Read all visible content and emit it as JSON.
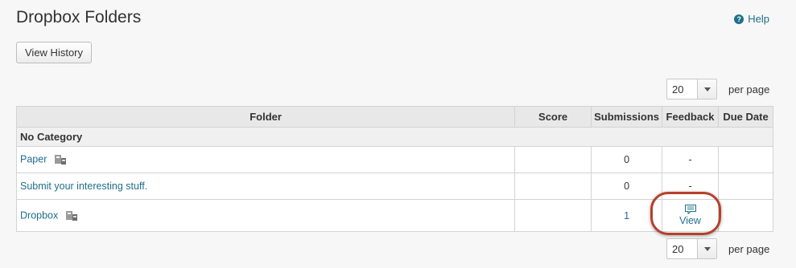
{
  "page": {
    "title": "Dropbox Folders",
    "help_label": "Help",
    "help_icon": "question-circle-icon"
  },
  "toolbar": {
    "view_history_label": "View History"
  },
  "pager_top": {
    "per_page_value": "20",
    "per_page_label": "per page"
  },
  "pager_bottom": {
    "per_page_value": "20",
    "per_page_label": "per page"
  },
  "table": {
    "headers": [
      "Folder",
      "Score",
      "Submissions",
      "Feedback",
      "Due Date"
    ],
    "category": "No Category",
    "rows": [
      {
        "folder": "Paper",
        "has_restriction_icon": true,
        "score": "",
        "submissions": "0",
        "feedback": "-",
        "due_date": ""
      },
      {
        "folder": "Submit your interesting stuff.",
        "has_restriction_icon": false,
        "score": "",
        "submissions": "0",
        "feedback": "-",
        "due_date": ""
      },
      {
        "folder": "Dropbox",
        "has_restriction_icon": true,
        "score": "",
        "submissions": "1",
        "feedback": "View",
        "due_date": ""
      }
    ]
  },
  "colors": {
    "link": "#1f6f8b",
    "highlight": "#b5402b",
    "header_bg": "#e8e8e8"
  }
}
